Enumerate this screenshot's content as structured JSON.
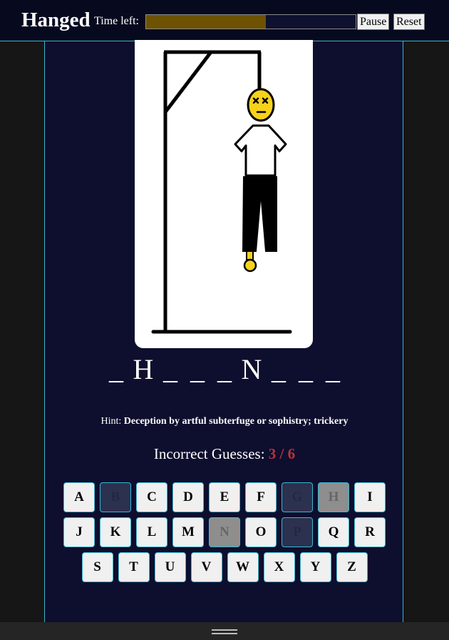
{
  "header": {
    "title": "Hanged",
    "time_label": "Time left:",
    "time_remaining_fraction": 0.57,
    "pause_label": "Pause",
    "reset_label": "Reset",
    "timer_color": "#6e5204"
  },
  "word": [
    "_",
    "H",
    "_",
    "_",
    "_",
    "N",
    "_",
    "_",
    "_"
  ],
  "hint": {
    "label": "Hint:",
    "text": "Deception by artful subterfuge or sophistry; trickery"
  },
  "incorrect": {
    "label": "Incorrect Guesses:",
    "count": "3 / 6"
  },
  "keyboard": {
    "rows": [
      [
        "A",
        "B",
        "C",
        "D",
        "E",
        "F",
        "G",
        "H",
        "I"
      ],
      [
        "J",
        "K",
        "L",
        "M",
        "N",
        "O",
        "P",
        "Q",
        "R"
      ],
      [
        "S",
        "T",
        "U",
        "V",
        "W",
        "X",
        "Y",
        "Z"
      ]
    ],
    "wrong_letters": [
      "B",
      "G",
      "P"
    ],
    "correct_letters": [
      "H",
      "N"
    ]
  },
  "colors": {
    "panel_bg": "#0e0e2e",
    "accent_border": "#3ab6c8",
    "error_count": "#b8323a",
    "figure_head": "#f7d21b"
  }
}
